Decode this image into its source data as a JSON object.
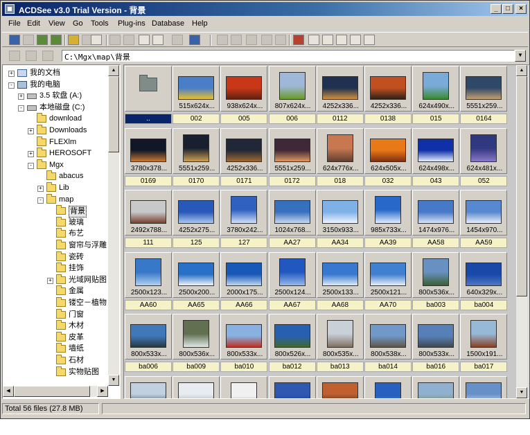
{
  "window": {
    "title": "ACDSee v3.0 Trial Version - 背景"
  },
  "menu": [
    "File",
    "Edit",
    "View",
    "Go",
    "Tools",
    "Plug-ins",
    "Database",
    "Help"
  ],
  "address": {
    "path": "C:\\Mgx\\map\\背景"
  },
  "tree": {
    "items": [
      {
        "label": "我的文档",
        "icon": "documents-icon",
        "level": 0,
        "pm": "+"
      },
      {
        "label": "我的电脑",
        "icon": "computer-icon",
        "level": 0,
        "pm": "-"
      },
      {
        "label": "3.5 软盘 (A:)",
        "icon": "floppy-icon",
        "level": 1,
        "pm": "+"
      },
      {
        "label": "本地磁盘 (C:)",
        "icon": "drive-icon",
        "level": 1,
        "pm": "-"
      },
      {
        "label": "download",
        "icon": "folder-icon",
        "level": 2,
        "pm": ""
      },
      {
        "label": "Downloads",
        "icon": "folder-icon",
        "level": 2,
        "pm": "+"
      },
      {
        "label": "FLEXlm",
        "icon": "folder-icon",
        "level": 2,
        "pm": ""
      },
      {
        "label": "HEROSOFT",
        "icon": "folder-icon",
        "level": 2,
        "pm": "+"
      },
      {
        "label": "Mgx",
        "icon": "folder-icon",
        "level": 2,
        "pm": "-"
      },
      {
        "label": "abacus",
        "icon": "folder-icon",
        "level": 3,
        "pm": ""
      },
      {
        "label": "Lib",
        "icon": "folder-icon",
        "level": 3,
        "pm": "+"
      },
      {
        "label": "map",
        "icon": "folder-icon",
        "level": 3,
        "pm": "-"
      },
      {
        "label": "背景",
        "icon": "folder-open-icon",
        "level": 4,
        "pm": "",
        "selected": true
      },
      {
        "label": "玻璃",
        "icon": "folder-icon",
        "level": 4,
        "pm": ""
      },
      {
        "label": "布艺",
        "icon": "folder-icon",
        "level": 4,
        "pm": ""
      },
      {
        "label": "窗帘与浮雕",
        "icon": "folder-icon",
        "level": 4,
        "pm": ""
      },
      {
        "label": "瓷砖",
        "icon": "folder-icon",
        "level": 4,
        "pm": ""
      },
      {
        "label": "挂饰",
        "icon": "folder-icon",
        "level": 4,
        "pm": ""
      },
      {
        "label": "光域网贴图",
        "icon": "folder-icon",
        "level": 4,
        "pm": "+"
      },
      {
        "label": "金属",
        "icon": "folder-icon",
        "level": 4,
        "pm": ""
      },
      {
        "label": "镂空－植物",
        "icon": "folder-icon",
        "level": 4,
        "pm": ""
      },
      {
        "label": "门窗",
        "icon": "folder-icon",
        "level": 4,
        "pm": ""
      },
      {
        "label": "木材",
        "icon": "folder-icon",
        "level": 4,
        "pm": ""
      },
      {
        "label": "皮革",
        "icon": "folder-icon",
        "level": 4,
        "pm": ""
      },
      {
        "label": "墙纸",
        "icon": "folder-icon",
        "level": 4,
        "pm": ""
      },
      {
        "label": "石材",
        "icon": "folder-icon",
        "level": 4,
        "pm": ""
      },
      {
        "label": "实物贴图",
        "icon": "folder-icon",
        "level": 4,
        "pm": ""
      }
    ]
  },
  "files": [
    {
      "name": "..",
      "dims": "",
      "type": "parent",
      "selected": true,
      "colors": [
        "#808c88",
        "#808c88"
      ]
    },
    {
      "name": "002",
      "dims": "515x624x...",
      "type": "image",
      "colors": [
        "#4a7ec8",
        "#e8c030"
      ]
    },
    {
      "name": "005",
      "dims": "938x624x...",
      "type": "image",
      "colors": [
        "#c83818",
        "#602010"
      ]
    },
    {
      "name": "006",
      "dims": "807x624x...",
      "type": "image",
      "colors": [
        "#a0b8d8",
        "#6a9a28"
      ]
    },
    {
      "name": "0112",
      "dims": "4252x336...",
      "type": "image",
      "colors": [
        "#203050",
        "#d09040"
      ]
    },
    {
      "name": "0138",
      "dims": "4252x336...",
      "type": "image",
      "colors": [
        "#c05020",
        "#302018"
      ]
    },
    {
      "name": "015",
      "dims": "624x490x...",
      "type": "image",
      "colors": [
        "#7aaad8",
        "#3a8a30"
      ]
    },
    {
      "name": "0164",
      "dims": "5551x259...",
      "type": "image",
      "colors": [
        "#304868",
        "#c0a070"
      ]
    },
    {
      "name": "0169",
      "dims": "3780x378...",
      "type": "image",
      "colors": [
        "#101828",
        "#c87830"
      ]
    },
    {
      "name": "0170",
      "dims": "5551x259...",
      "type": "image",
      "colors": [
        "#182030",
        "#d0a050"
      ]
    },
    {
      "name": "0171",
      "dims": "4252x336...",
      "type": "image",
      "colors": [
        "#202838",
        "#a06830"
      ]
    },
    {
      "name": "0172",
      "dims": "5551x259...",
      "type": "image",
      "colors": [
        "#402838",
        "#e09860"
      ]
    },
    {
      "name": "018",
      "dims": "624x776x...",
      "type": "image",
      "colors": [
        "#c87850",
        "#604030"
      ]
    },
    {
      "name": "032",
      "dims": "624x505x...",
      "type": "image",
      "colors": [
        "#e87818",
        "#803010"
      ]
    },
    {
      "name": "043",
      "dims": "624x498x...",
      "type": "image",
      "colors": [
        "#1030a8",
        "#e8f0ff"
      ]
    },
    {
      "name": "052",
      "dims": "624x481x...",
      "type": "image",
      "colors": [
        "#303880",
        "#8878c8"
      ]
    },
    {
      "name": "111",
      "dims": "2492x788...",
      "type": "image",
      "colors": [
        "#c8c8c8",
        "#784030"
      ]
    },
    {
      "name": "125",
      "dims": "4252x275...",
      "type": "image",
      "colors": [
        "#2858b8",
        "#a8c8f0"
      ]
    },
    {
      "name": "127",
      "dims": "3780x242...",
      "type": "image",
      "colors": [
        "#3060c0",
        "#d0e0f8"
      ]
    },
    {
      "name": "AA27",
      "dims": "1024x768...",
      "type": "image",
      "colors": [
        "#3870c0",
        "#c8d8f0"
      ]
    },
    {
      "name": "AA34",
      "dims": "3150x933...",
      "type": "image",
      "colors": [
        "#80b0e8",
        "#f0f4ff"
      ]
    },
    {
      "name": "AA39",
      "dims": "985x733x...",
      "type": "image",
      "colors": [
        "#2868c8",
        "#e0ecff"
      ]
    },
    {
      "name": "AA58",
      "dims": "1474x976...",
      "type": "image",
      "colors": [
        "#4878c8",
        "#d8e4f8"
      ]
    },
    {
      "name": "AA59",
      "dims": "1454x970...",
      "type": "image",
      "colors": [
        "#5888d0",
        "#e8eef8"
      ]
    },
    {
      "name": "AA60",
      "dims": "2500x123...",
      "type": "image",
      "colors": [
        "#3878c8",
        "#b0d0f0"
      ]
    },
    {
      "name": "AA65",
      "dims": "2500x200...",
      "type": "image",
      "colors": [
        "#2870c8",
        "#f0f4f8"
      ]
    },
    {
      "name": "AA66",
      "dims": "2000x175...",
      "type": "image",
      "colors": [
        "#1858b8",
        "#c0d8f0"
      ]
    },
    {
      "name": "AA67",
      "dims": "2500x124...",
      "type": "image",
      "colors": [
        "#2058c0",
        "#98b8e8"
      ]
    },
    {
      "name": "AA68",
      "dims": "2500x133...",
      "type": "image",
      "colors": [
        "#3878d0",
        "#e0ecf8"
      ]
    },
    {
      "name": "AA70",
      "dims": "2500x121...",
      "type": "image",
      "colors": [
        "#4080d0",
        "#e8f0f8"
      ]
    },
    {
      "name": "ba003",
      "dims": "800x536x...",
      "type": "image",
      "colors": [
        "#6890c0",
        "#3a6030"
      ]
    },
    {
      "name": "ba004",
      "dims": "640x329x...",
      "type": "image",
      "colors": [
        "#1848a8",
        "#5078c0"
      ]
    },
    {
      "name": "ba006",
      "dims": "800x533x...",
      "type": "image",
      "colors": [
        "#4078b8",
        "#283840"
      ]
    },
    {
      "name": "ba009",
      "dims": "800x536x...",
      "type": "image",
      "colors": [
        "#607050",
        "#e0e8e8"
      ]
    },
    {
      "name": "ba010",
      "dims": "800x533x...",
      "type": "image",
      "colors": [
        "#88b0e0",
        "#c03020"
      ]
    },
    {
      "name": "ba012",
      "dims": "800x526x...",
      "type": "image",
      "colors": [
        "#2860b0",
        "#406830"
      ]
    },
    {
      "name": "ba013",
      "dims": "800x535x...",
      "type": "image",
      "colors": [
        "#c8d0d8",
        "#807060"
      ]
    },
    {
      "name": "ba014",
      "dims": "800x538x...",
      "type": "image",
      "colors": [
        "#7098c8",
        "#605848"
      ]
    },
    {
      "name": "ba016",
      "dims": "800x533x...",
      "type": "image",
      "colors": [
        "#5880b8",
        "#404850"
      ]
    },
    {
      "name": "ba017",
      "dims": "1500x191...",
      "type": "image",
      "colors": [
        "#98b8d8",
        "#884020"
      ]
    },
    {
      "name": "",
      "dims": "",
      "type": "image",
      "colors": [
        "#c0d0e0",
        "#405060"
      ]
    },
    {
      "name": "",
      "dims": "",
      "type": "image",
      "colors": [
        "#e8ecf0",
        "#a0a8b0"
      ]
    },
    {
      "name": "",
      "dims": "",
      "type": "image",
      "colors": [
        "#f0f0f0",
        "#608050"
      ]
    },
    {
      "name": "",
      "dims": "",
      "type": "image",
      "colors": [
        "#3058b0",
        "#1838a0"
      ]
    },
    {
      "name": "",
      "dims": "",
      "type": "image",
      "colors": [
        "#c06030",
        "#402818"
      ]
    },
    {
      "name": "",
      "dims": "",
      "type": "image",
      "colors": [
        "#2860c0",
        "#80a8e0"
      ]
    },
    {
      "name": "",
      "dims": "",
      "type": "image",
      "colors": [
        "#90b0d0",
        "#708848"
      ]
    },
    {
      "name": "",
      "dims": "",
      "type": "image",
      "colors": [
        "#6890c8",
        "#d8e0f0"
      ]
    }
  ],
  "status": {
    "text": "Total 56 files (27.8 MB)"
  }
}
